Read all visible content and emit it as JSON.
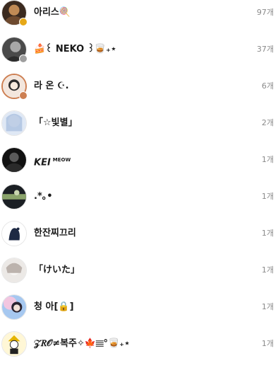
{
  "friends": [
    {
      "name": "아리스🍭",
      "count": "97개",
      "badge_color": "#e6a817",
      "avatar_colors": [
        "#3b2a1f",
        "#c08a55"
      ]
    },
    {
      "name": "🍰꒰ NEKO ꒱🥃₊⋆",
      "count": "37개",
      "badge_color": "#9e9e9e",
      "avatar_colors": [
        "#4a4a4a",
        "#a8a8a8"
      ]
    },
    {
      "name": "라 온 ☪︎.",
      "count": "6개",
      "badge_color": "#cd7f52",
      "avatar_colors": [
        "#f3e6dd",
        "#2b2b2b"
      ]
    },
    {
      "name": "「☆빛별」",
      "count": "2개",
      "badge_color": "",
      "avatar_colors": [
        "#dfe8f5",
        "#9bb4d8"
      ]
    },
    {
      "name": "KEI",
      "name_suffix": "MEOW",
      "count": "1개",
      "badge_color": "",
      "avatar_colors": [
        "#111111",
        "#5a5a5a"
      ]
    },
    {
      "name": ".*｡•",
      "count": "1개",
      "badge_color": "",
      "avatar_colors": [
        "#1b1f24",
        "#8aa36b"
      ]
    },
    {
      "name": "한잔찌끄리",
      "count": "1개",
      "badge_color": "",
      "avatar_colors": [
        "#ffffff",
        "#1e2a44"
      ]
    },
    {
      "name": "「けいた」",
      "count": "1개",
      "badge_color": "",
      "avatar_colors": [
        "#ece9e6",
        "#bcb3ad"
      ]
    },
    {
      "name": "청 아[🔒]",
      "count": "1개",
      "badge_color": "",
      "avatar_colors": [
        "#f2c6e0",
        "#a6c8f0"
      ]
    },
    {
      "name": "𝒵𝑅𝒪≠복주✧🍁𝄙°🥃₊⋆",
      "count": "1개",
      "badge_color": "",
      "avatar_colors": [
        "#fff7d6",
        "#e4b400"
      ]
    }
  ]
}
